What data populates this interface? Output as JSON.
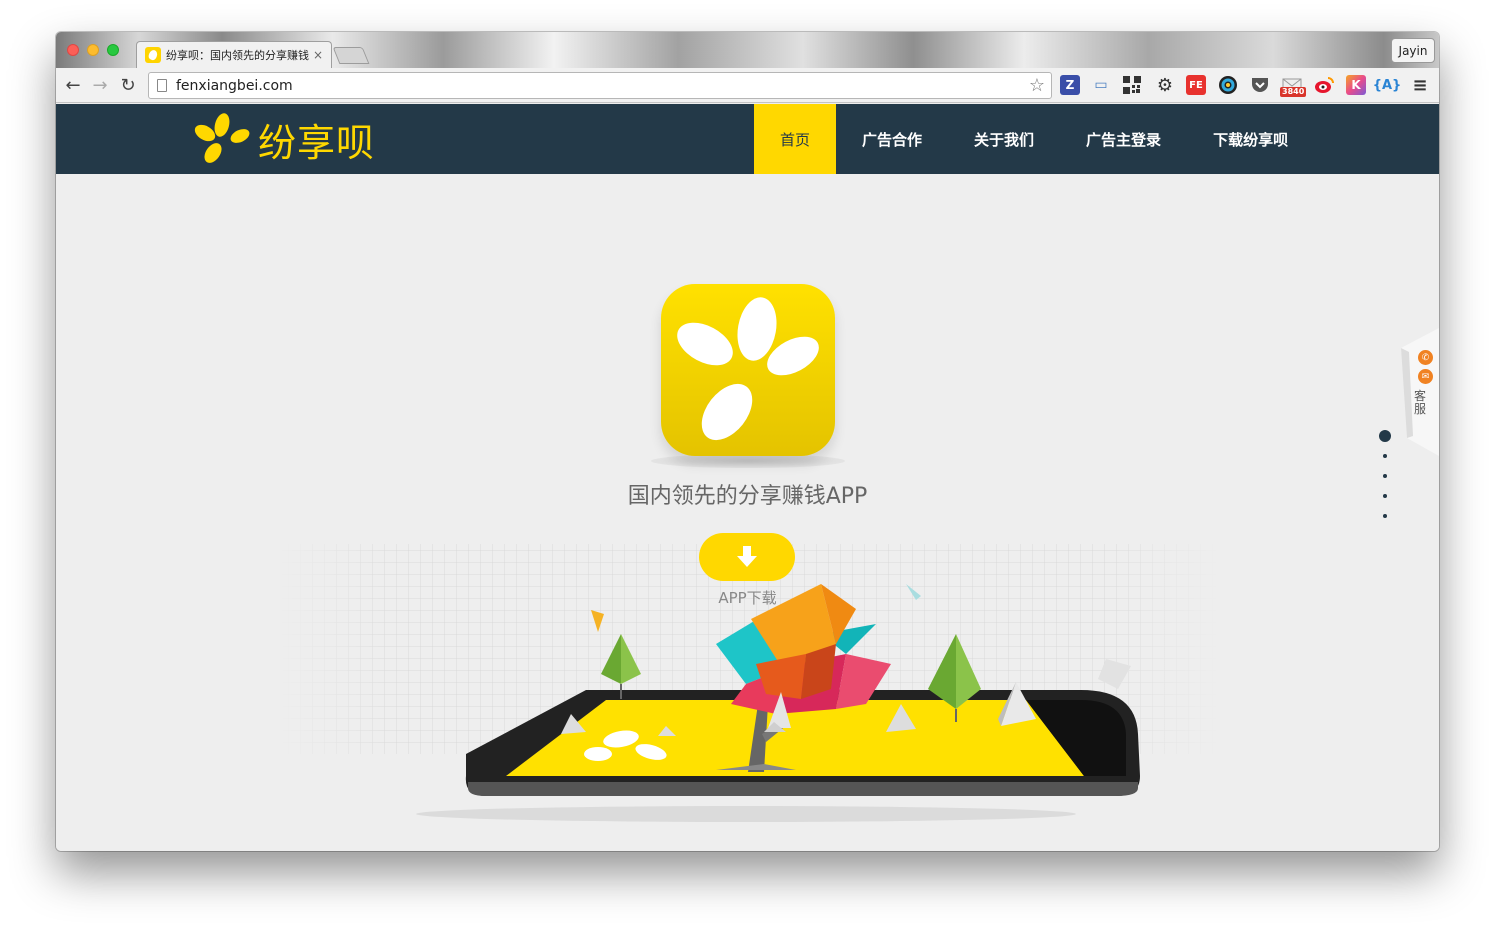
{
  "browser": {
    "tab_title": "纷享呗：国内领先的分享赚钱",
    "tab_close": "×",
    "profile_name": "Jayin",
    "url": "fenxiangbei.com",
    "ext_badge": "3840",
    "icons": [
      "back-arrow-icon",
      "forward-arrow-icon",
      "reload-icon",
      "bookmark-star-icon",
      "menu-icon"
    ]
  },
  "site": {
    "logo_text": "纷享呗",
    "nav": [
      {
        "label": "首页",
        "active": true
      },
      {
        "label": "广告合作",
        "active": false
      },
      {
        "label": "关于我们",
        "active": false
      },
      {
        "label": "广告主登录",
        "active": false
      },
      {
        "label": "下载纷享呗",
        "active": false
      }
    ],
    "tagline": "国内领先的分享赚钱APP",
    "download_label": "APP下载",
    "customer_service": "客服",
    "pager_count": 5,
    "pager_active_index": 0
  },
  "colors": {
    "header_bg": "#233948",
    "accent_yellow": "#ffd800",
    "page_bg": "#eeeeee",
    "service_orange": "#f08222"
  }
}
